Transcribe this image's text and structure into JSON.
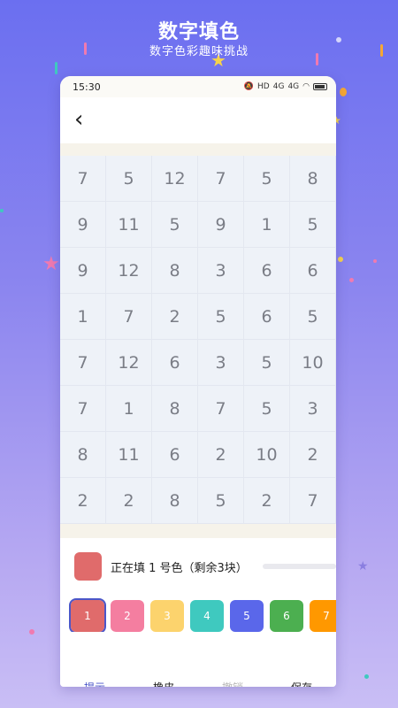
{
  "hero": {
    "title": "数字填色",
    "subtitle": "数字色彩趣味挑战"
  },
  "status_bar": {
    "time": "15:30",
    "icons": [
      "mute-icon",
      "hd-icon",
      "signal-4g-icon",
      "signal-4g-icon",
      "wifi-icon",
      "battery-icon"
    ],
    "hd_label": "HD",
    "net1_label": "4G",
    "net2_label": "4G"
  },
  "nav": {
    "back_icon": "chevron-left-icon",
    "back_glyph": "‹"
  },
  "grid": {
    "rows": [
      [
        "7",
        "5",
        "12",
        "7",
        "5",
        "8"
      ],
      [
        "9",
        "11",
        "5",
        "9",
        "1",
        "5"
      ],
      [
        "9",
        "12",
        "8",
        "3",
        "6",
        "6"
      ],
      [
        "1",
        "7",
        "2",
        "5",
        "6",
        "5"
      ],
      [
        "7",
        "12",
        "6",
        "3",
        "5",
        "10"
      ],
      [
        "7",
        "1",
        "8",
        "7",
        "5",
        "3"
      ],
      [
        "8",
        "11",
        "6",
        "2",
        "10",
        "2"
      ],
      [
        "2",
        "2",
        "8",
        "5",
        "2",
        "7"
      ]
    ]
  },
  "current": {
    "text": "正在填 1 号色（剩余3块）",
    "color": "#e06b6b",
    "progress": 0
  },
  "palette": [
    {
      "label": "1",
      "color": "#e06b6b",
      "selected": true
    },
    {
      "label": "2",
      "color": "#f47ea0",
      "selected": false
    },
    {
      "label": "3",
      "color": "#fcd36d",
      "selected": false
    },
    {
      "label": "4",
      "color": "#3fc9bf",
      "selected": false
    },
    {
      "label": "5",
      "color": "#5a67ea",
      "selected": false
    },
    {
      "label": "6",
      "color": "#4caf50",
      "selected": false
    },
    {
      "label": "7",
      "color": "#ff9800",
      "selected": false
    }
  ],
  "actions": {
    "hint": "提示",
    "eraser": "橡皮",
    "undo": "撤销",
    "save": "保存"
  },
  "colors": {
    "hint": "#4b56c8",
    "eraser": "#222222",
    "undo": "#b8b8b8",
    "save": "#222222"
  }
}
